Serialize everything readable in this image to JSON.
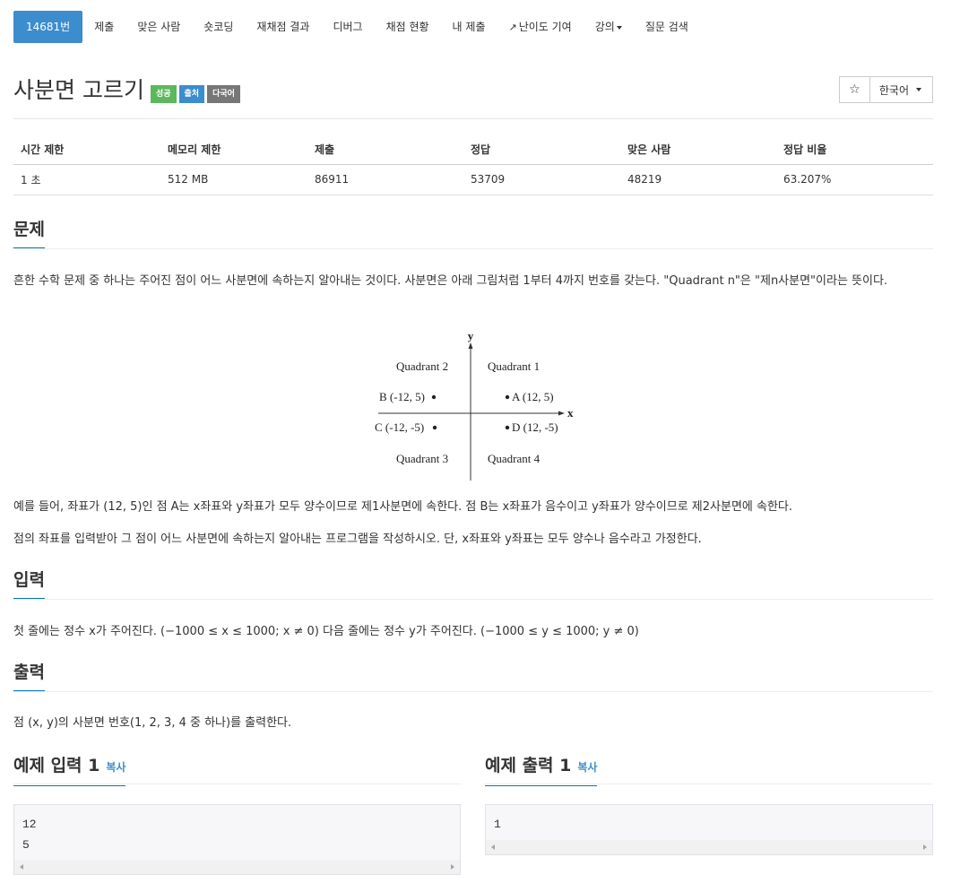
{
  "nav": {
    "items": [
      {
        "label": "14681번",
        "active": true
      },
      {
        "label": "제출"
      },
      {
        "label": "맞은 사람"
      },
      {
        "label": "숏코딩"
      },
      {
        "label": "재채점 결과"
      },
      {
        "label": "디버그"
      },
      {
        "label": "채점 현황"
      },
      {
        "label": "내 제출"
      },
      {
        "label": "난이도 기여",
        "icon": "external-link-icon"
      },
      {
        "label": "강의",
        "dropdown": true
      },
      {
        "label": "질문 검색"
      }
    ]
  },
  "problem": {
    "title": "사분면 고르기",
    "badges": [
      "성공",
      "출처",
      "다국어"
    ],
    "star_icon": "☆",
    "language": "한국어"
  },
  "stats": {
    "headers": [
      "시간 제한",
      "메모리 제한",
      "제출",
      "정답",
      "맞은 사람",
      "정답 비율"
    ],
    "values": [
      "1 초",
      "512 MB",
      "86911",
      "53709",
      "48219",
      "63.207%"
    ]
  },
  "sections": {
    "problem_heading": "문제",
    "problem_text_1": "흔한 수학 문제 중 하나는 주어진 점이 어느 사분면에 속하는지 알아내는 것이다. 사분면은 아래 그림처럼 1부터 4까지 번호를 갖는다. \"Quadrant n\"은 \"제n사분면\"이라는 뜻이다.",
    "problem_text_2": "예를 들어, 좌표가 (12, 5)인 점 A는 x좌표와 y좌표가 모두 양수이므로 제1사분면에 속한다. 점 B는 x좌표가 음수이고 y좌표가 양수이므로 제2사분면에 속한다.",
    "problem_text_3": "점의 좌표를 입력받아 그 점이 어느 사분면에 속하는지 알아내는 프로그램을 작성하시오. 단, x좌표와 y좌표는 모두 양수나 음수라고 가정한다.",
    "input_heading": "입력",
    "input_text": "첫 줄에는 정수 x가 주어진다. (−1000 ≤ x ≤ 1000; x ≠ 0) 다음 줄에는 정수 y가 주어진다. (−1000 ≤ y ≤ 1000; y ≠ 0)",
    "output_heading": "출력",
    "output_text": "점 (x, y)의 사분면 번호(1, 2, 3, 4 중 하나)를 출력한다."
  },
  "diagram": {
    "y_label": "y",
    "x_label": "x",
    "q1": "Quadrant 1",
    "q2": "Quadrant 2",
    "q3": "Quadrant 3",
    "q4": "Quadrant 4",
    "a": "A (12, 5)",
    "b": "B (-12, 5)",
    "c": "C (-12, -5)",
    "d": "D (12, -5)"
  },
  "samples": {
    "input_heading": "예제 입력 1",
    "output_heading": "예제 출력 1",
    "copy_label": "복사",
    "input_lines": "12\n5",
    "output_lines": "1"
  }
}
